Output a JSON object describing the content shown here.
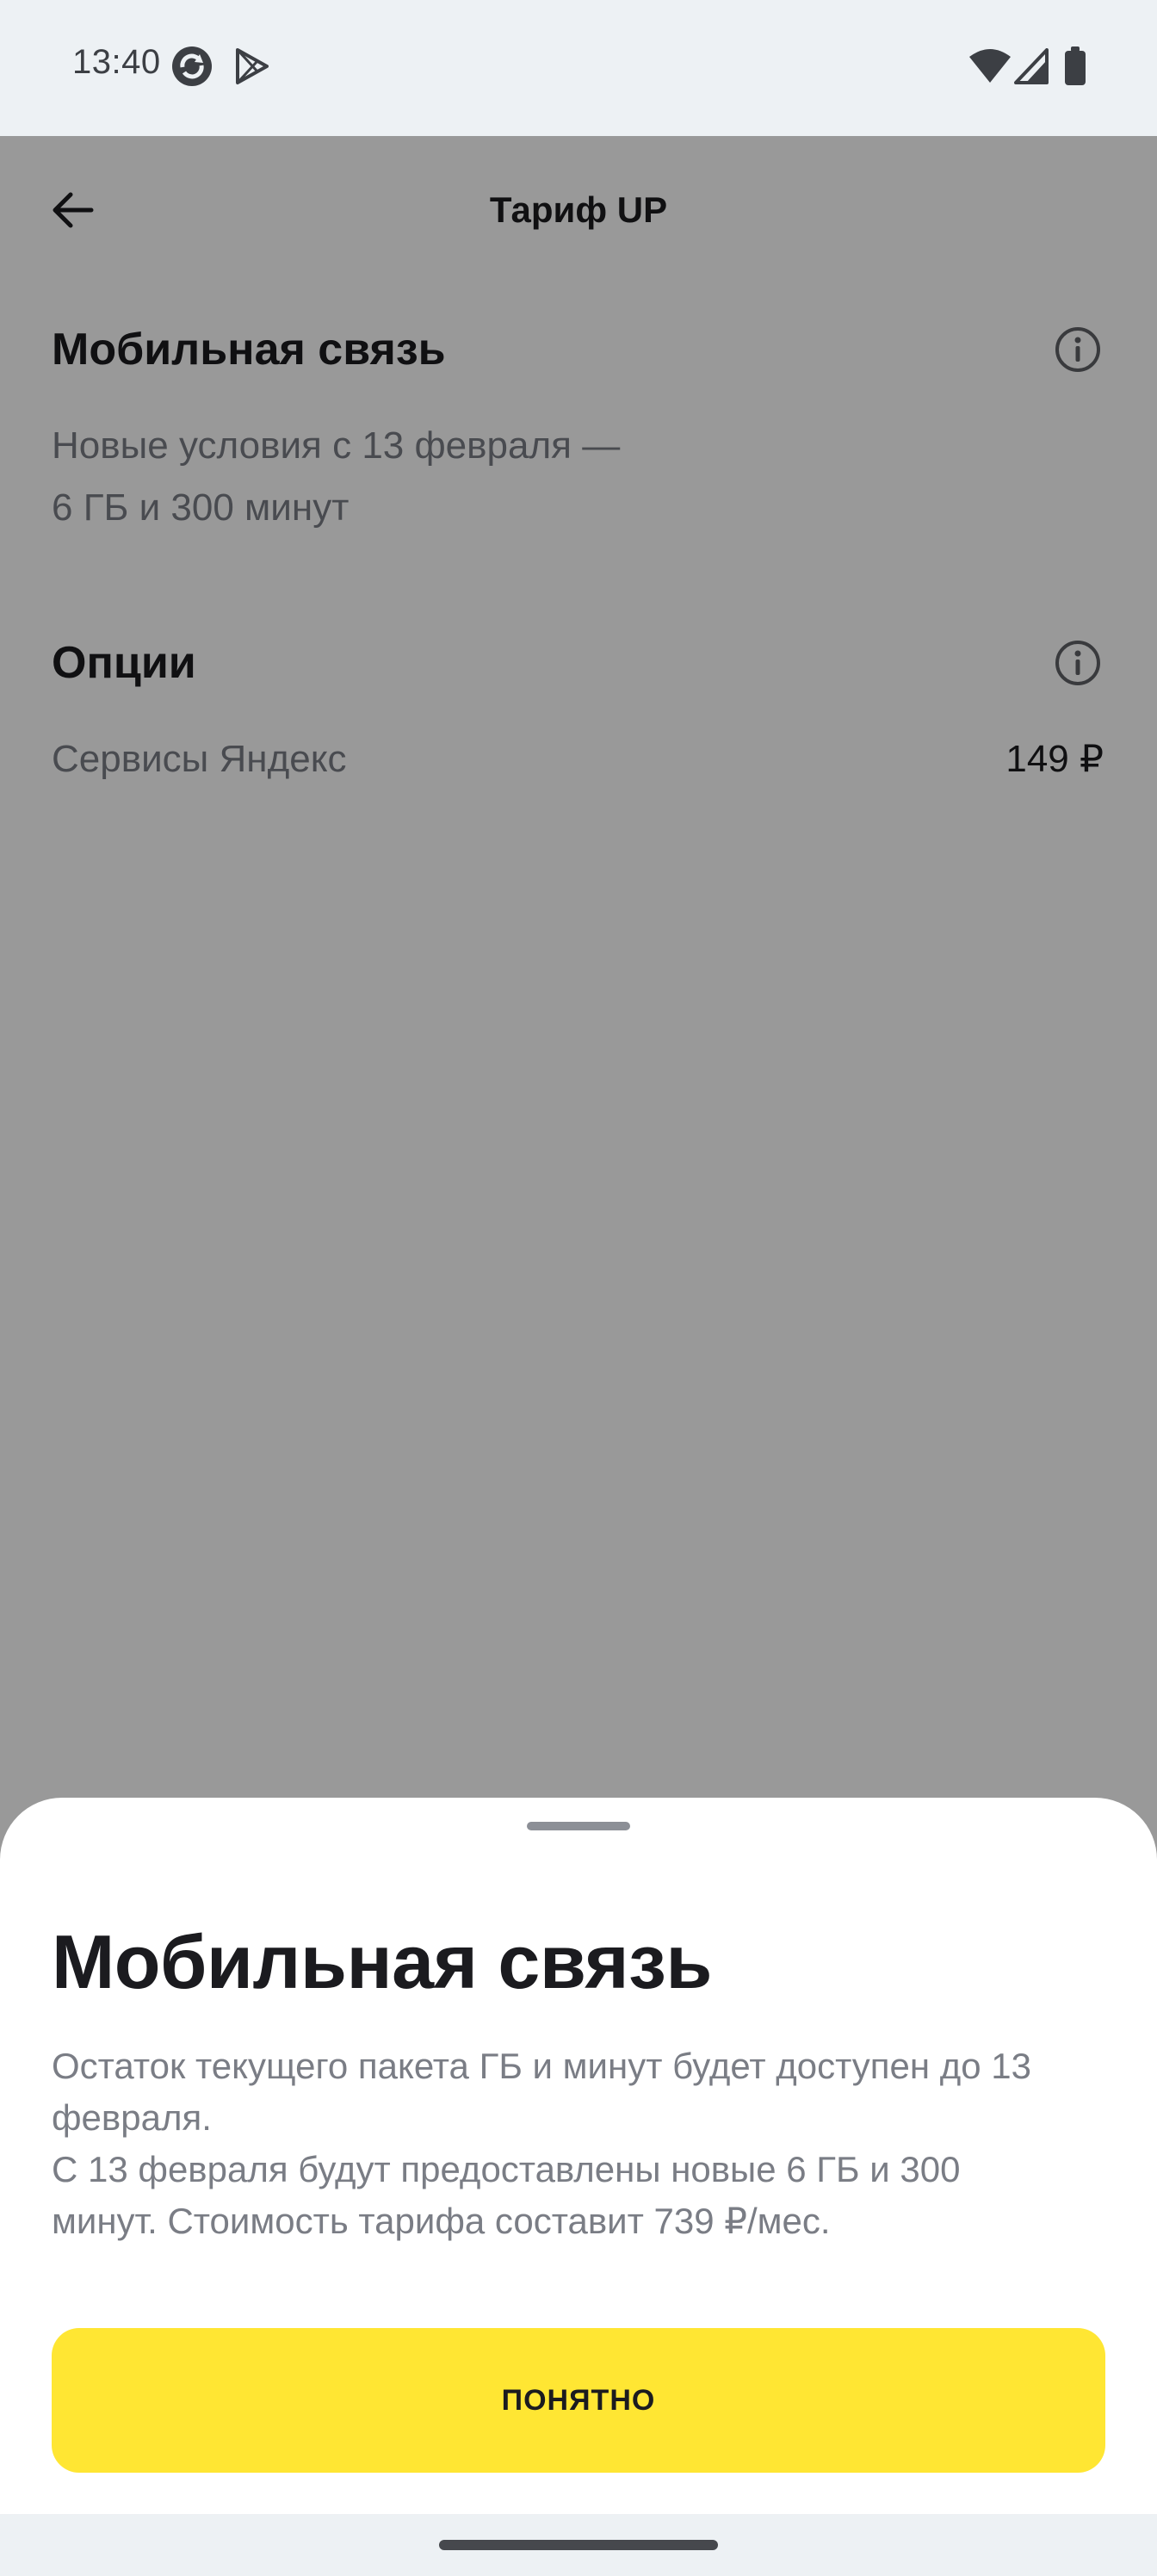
{
  "status_bar": {
    "time": "13:40",
    "left_icons": [
      "sync-app-icon",
      "play-store-icon"
    ],
    "right_icons": [
      "wifi-icon",
      "cell-signal-icon",
      "battery-icon"
    ]
  },
  "app_bar": {
    "title": "Тариф UP",
    "back_icon": "arrow-left-icon"
  },
  "sections": {
    "mobile": {
      "title": "Мобильная связь",
      "line1": "Новые условия с 13 февраля —",
      "line2": "6 ГБ и 300 минут"
    },
    "options": {
      "title": "Опции",
      "item_label": "Сервисы Яндекс",
      "item_price": "149 ₽"
    }
  },
  "sheet": {
    "title": "Мобильная связь",
    "line1": "Остаток текущего пакета ГБ и минут будет доступен до 13",
    "line2": "февраля.",
    "line3": "С 13 февраля будут предоставлены новые 6 ГБ и 300",
    "line4": "минут. Стоимость тарифа составит 739 ₽/мес.",
    "button_label": "ПОНЯТНО"
  },
  "colors": {
    "accent_yellow": "#ffe633",
    "scrim": "rgba(0,0,0,0.40)",
    "text_primary": "#1b1b1f",
    "text_secondary": "#7a7d85"
  }
}
